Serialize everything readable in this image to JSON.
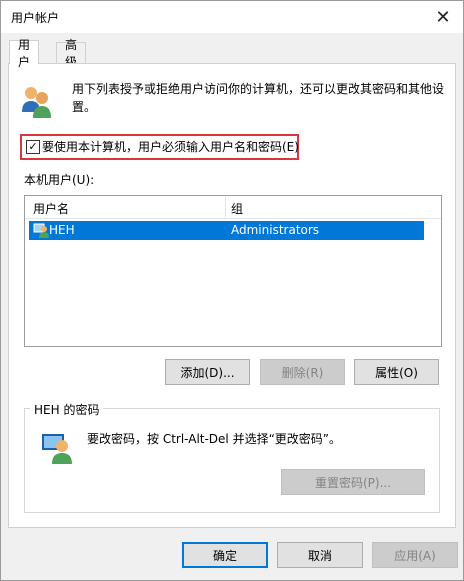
{
  "window": {
    "title": "用户帐户",
    "close_glyph": "✕"
  },
  "tabs": [
    {
      "label": "用户",
      "active": true
    },
    {
      "label": "高级",
      "active": false
    }
  ],
  "intro": {
    "text": "用下列表授予或拒绝用户访问你的计算机，还可以更改其密码和其他设置。",
    "icon": "users-icon"
  },
  "require_login": {
    "label": "要使用本计算机，用户必须输入用户名和密码(E)",
    "checked": true
  },
  "local_users": {
    "label": "本机用户(U):",
    "columns": [
      "用户名",
      "组"
    ],
    "rows": [
      {
        "name": "HEH",
        "group": "Administrators",
        "selected": true
      }
    ]
  },
  "buttons": {
    "add": "添加(D)...",
    "remove": "删除(R)",
    "properties": "属性(O)",
    "reset_password": "重置密码(P)...",
    "ok": "确定",
    "cancel": "取消",
    "apply": "应用(A)"
  },
  "password_group": {
    "title": "HEH 的密码",
    "text": "要改密码，按 Ctrl-Alt-Del 并选择“更改密码”。",
    "icon": "password-user-icon"
  },
  "colors": {
    "selection": "#0078d7",
    "highlight_frame": "#d9363e"
  }
}
